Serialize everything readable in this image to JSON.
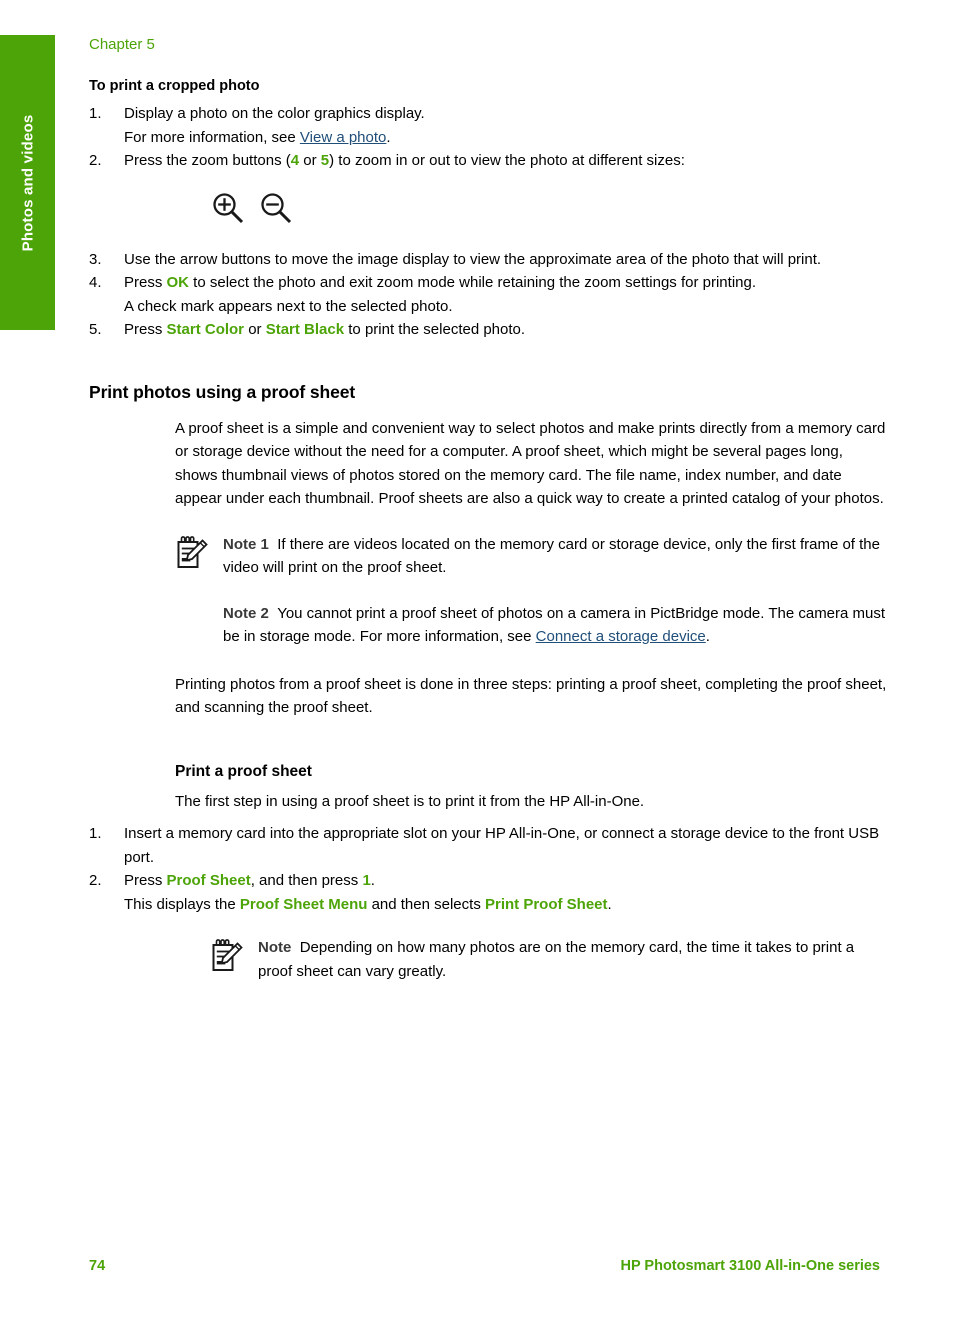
{
  "page": {
    "number": "74",
    "chapter_label": "Chapter 5",
    "side_tab_label": "Photos and videos",
    "footer_title": "HP Photosmart 3100 All-in-One series",
    "accent_green": "#4CA408",
    "link_blue": "#1F4E79",
    "note_label_gray": "#3a3a3a"
  },
  "cropped_photo": {
    "heading": "To print a cropped photo",
    "step1": {
      "num": "1.",
      "line1": "Display a photo on the color graphics display.",
      "line2_prefix": "For more information, see ",
      "line2_link": "View a photo",
      "line2_suffix": "."
    },
    "step2": {
      "num": "2.",
      "part1": "Press the zoom buttons (",
      "key_a": "4",
      "part2": " or ",
      "key_b": "5",
      "part3": ") to zoom in or out to view the photo at different sizes:"
    },
    "zoom_icons": [
      {
        "name": "zoom-in-icon",
        "label": "Zoom in"
      },
      {
        "name": "zoom-out-icon",
        "label": "Zoom out"
      }
    ],
    "step3": {
      "num": "3.",
      "text": "Use the arrow buttons to move the image display to view the approximate area of the photo that will print."
    },
    "step4": {
      "num": "4.",
      "part1": "Press ",
      "key": "OK",
      "part2": " to select the photo and exit zoom mode while retaining the zoom settings for printing.",
      "subline": "A check mark appears next to the selected photo."
    },
    "step5": {
      "num": "5.",
      "part1": "Press ",
      "key_a": "Start Color",
      "part2": " or ",
      "key_b": "Start Black",
      "part3": " to print the selected photo."
    }
  },
  "proof_sheet": {
    "heading": "Print photos using a proof sheet",
    "intro": "A proof sheet is a simple and convenient way to select photos and make prints directly from a memory card or storage device without the need for a computer. A proof sheet, which might be several pages long, shows thumbnail views of photos stored on the memory card. The file name, index number, and date appear under each thumbnail. Proof sheets are also a quick way to create a printed catalog of your photos.",
    "note1": {
      "label": "Note 1",
      "text": "If there are videos located on the memory card or storage device, only the first frame of the video will print on the proof sheet."
    },
    "note2": {
      "label": "Note 2",
      "text_before": "You cannot print a proof sheet of photos on a camera in PictBridge mode. The camera must be in storage mode. For more information, see ",
      "link": "Connect a storage device",
      "text_after": "."
    },
    "three_steps": "Printing photos from a proof sheet is done in three steps: printing a proof sheet, completing the proof sheet, and scanning the proof sheet."
  },
  "print_proof_sheet": {
    "heading": "Print a proof sheet",
    "intro": "The first step in using a proof sheet is to print it from the HP All-in-One.",
    "step1": {
      "num": "1.",
      "text": "Insert a memory card into the appropriate slot on your HP All-in-One, or connect a storage device to the front USB port."
    },
    "step2": {
      "num": "2.",
      "part1": "Press ",
      "key_a": "Proof Sheet",
      "part2": ", and then press ",
      "key_b": "1",
      "part3": ".",
      "subline_part1": "This displays the ",
      "subline_key_a": "Proof Sheet Menu",
      "subline_part2": " and then selects ",
      "subline_key_b": "Print Proof Sheet",
      "subline_part3": "."
    },
    "note": {
      "label": "Note",
      "text": "Depending on how many photos are on the memory card, the time it takes to print a proof sheet can vary greatly."
    }
  }
}
